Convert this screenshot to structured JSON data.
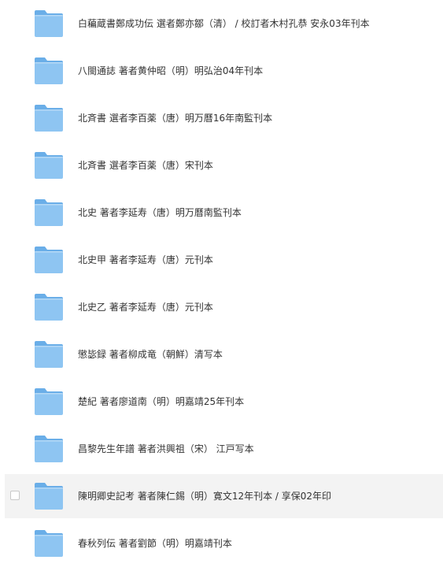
{
  "files": [
    {
      "name": "白藊蔵書鄭成功伝  選者鄭亦鄒（清） / 校訂者木村孔恭 安永03年刊本",
      "hovered": false
    },
    {
      "name": "八閩通誌  著者黄仲昭（明）明弘治04年刊本",
      "hovered": false
    },
    {
      "name": "北斉書  選者李百薬（唐）明万曆16年南監刊本",
      "hovered": false
    },
    {
      "name": "北斉書  選者李百薬（唐）宋刊本",
      "hovered": false
    },
    {
      "name": "北史 著者李延寿（唐）明万曆南監刊本",
      "hovered": false
    },
    {
      "name": "北史甲  著者李延寿（唐）元刊本",
      "hovered": false
    },
    {
      "name": "北史乙  著者李延寿（唐）元刊本",
      "hovered": false
    },
    {
      "name": "懲毖録  著者柳成竜（朝鮮）清写本",
      "hovered": false
    },
    {
      "name": "楚紀  著者廖道南（明）明嘉靖25年刊本",
      "hovered": false
    },
    {
      "name": "昌黎先生年譜 著者洪興祖（宋） 江戸写本",
      "hovered": false
    },
    {
      "name": "陳明卿史記考 著者陳仁錫（明）寛文12年刊本 / 享保02年印",
      "hovered": true
    },
    {
      "name": "春秋列伝  著者劉節（明）明嘉靖刊本",
      "hovered": false
    }
  ],
  "icon": "folder-icon",
  "colors": {
    "folder_front": "#8ec5f2",
    "folder_back": "#6aaee8",
    "hover_background": "#f3f3f3",
    "text": "#333333"
  }
}
